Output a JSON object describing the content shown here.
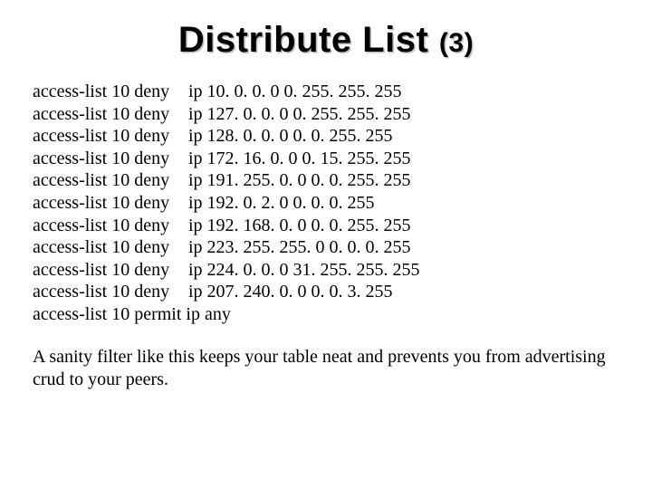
{
  "title": {
    "main": "Distribute List",
    "sub": "(3)"
  },
  "acl": [
    {
      "c1": "access-list 10 deny",
      "c2": "ip 10. 0. 0. 0 0. 255. 255. 255"
    },
    {
      "c1": "access-list 10 deny",
      "c2": "ip 127. 0. 0. 0 0. 255. 255. 255"
    },
    {
      "c1": "access-list 10 deny",
      "c2": "ip 128. 0. 0. 0 0. 0. 255. 255"
    },
    {
      "c1": "access-list 10 deny",
      "c2": "ip 172. 16. 0. 0 0. 15. 255. 255"
    },
    {
      "c1": "access-list 10 deny",
      "c2": "ip 191. 255. 0. 0 0. 0. 255. 255"
    },
    {
      "c1": "access-list 10 deny",
      "c2": "ip 192. 0. 2. 0 0. 0. 0. 255"
    },
    {
      "c1": "access-list 10 deny",
      "c2": "ip 192. 168. 0. 0 0. 0. 255. 255"
    },
    {
      "c1": "access-list 10 deny",
      "c2": "ip 223. 255. 255. 0 0. 0. 0. 255"
    },
    {
      "c1": "access-list 10 deny",
      "c2": "ip 224. 0. 0. 0 31. 255. 255. 255"
    },
    {
      "c1": "access-list 10 deny",
      "c2": "ip 207. 240. 0. 0 0. 0. 3. 255"
    },
    {
      "c1": "access-list 10 permit ip any",
      "c2": ""
    }
  ],
  "note": "A sanity filter like this keeps your table neat and prevents you from advertising crud to your peers."
}
